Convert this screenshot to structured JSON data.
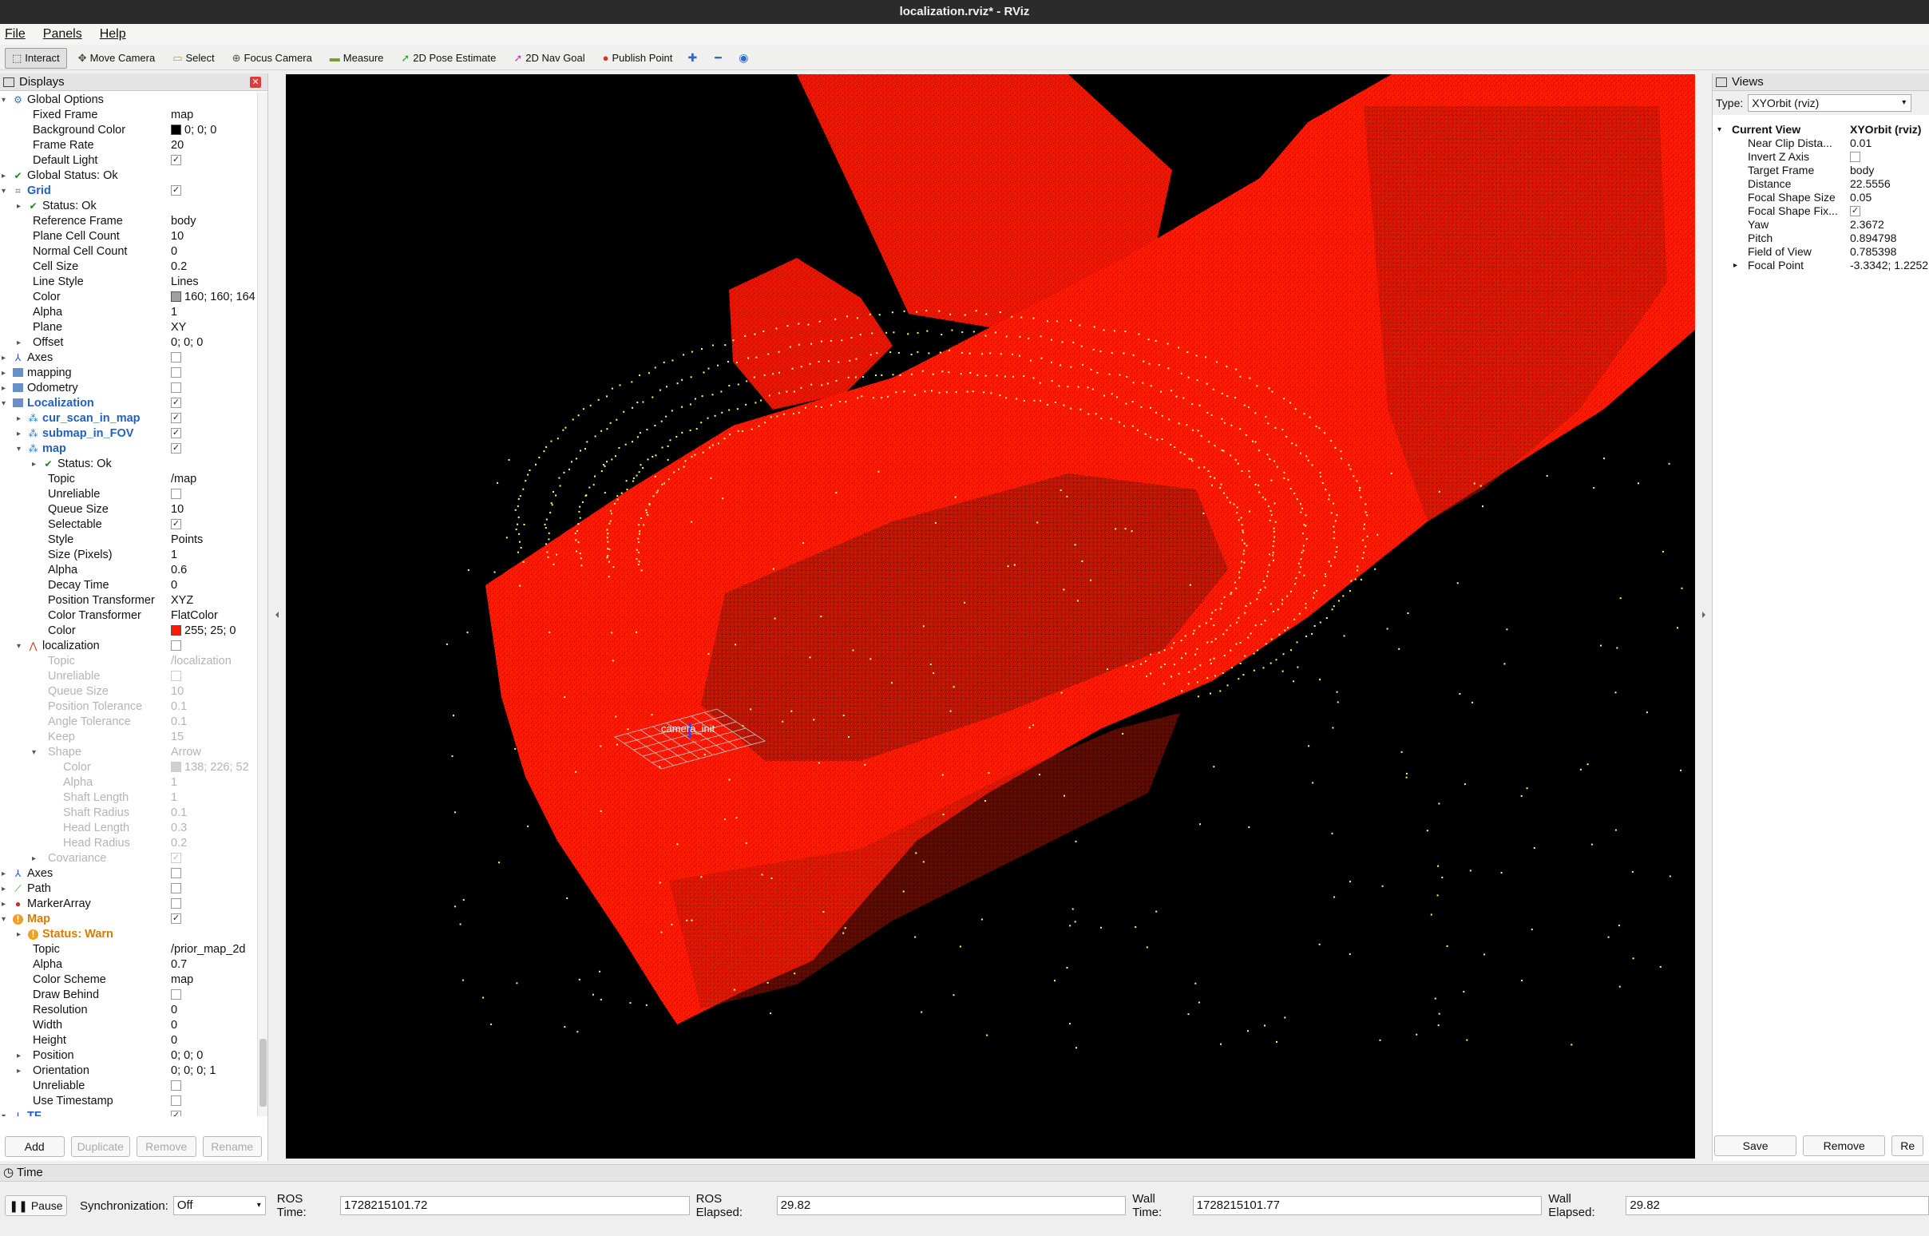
{
  "window": {
    "title": "localization.rviz* - RViz"
  },
  "menu": [
    "File",
    "Panels",
    "Help"
  ],
  "toolbar": [
    {
      "label": "Interact",
      "icon": "interact-icon",
      "active": true
    },
    {
      "label": "Move Camera",
      "icon": "move-camera-icon"
    },
    {
      "label": "Select",
      "icon": "select-icon"
    },
    {
      "label": "Focus Camera",
      "icon": "focus-camera-icon"
    },
    {
      "label": "Measure",
      "icon": "measure-icon"
    },
    {
      "label": "2D Pose Estimate",
      "icon": "pose-estimate-icon"
    },
    {
      "label": "2D Nav Goal",
      "icon": "nav-goal-icon"
    },
    {
      "label": "Publish Point",
      "icon": "publish-point-icon"
    }
  ],
  "displays": {
    "title": "Displays",
    "rows": [
      {
        "d": 0,
        "arrow": "▾",
        "icon": "gear",
        "label": "Global Options"
      },
      {
        "d": 1,
        "label": "Fixed Frame",
        "value": "map"
      },
      {
        "d": 1,
        "label": "Background Color",
        "value": "0; 0; 0",
        "swatch": "#000000"
      },
      {
        "d": 1,
        "label": "Frame Rate",
        "value": "20"
      },
      {
        "d": 1,
        "label": "Default Light",
        "check": true
      },
      {
        "d": 0,
        "arrow": "▸",
        "icon": "ok",
        "label": "Global Status: Ok"
      },
      {
        "d": 0,
        "arrow": "▾",
        "icon": "grid",
        "label": "Grid",
        "style": "blue",
        "check": true
      },
      {
        "d": 1,
        "arrow": "▸",
        "icon": "ok",
        "label": "Status: Ok"
      },
      {
        "d": 1,
        "label": "Reference Frame",
        "value": "body"
      },
      {
        "d": 1,
        "label": "Plane Cell Count",
        "value": "10"
      },
      {
        "d": 1,
        "label": "Normal Cell Count",
        "value": "0"
      },
      {
        "d": 1,
        "label": "Cell Size",
        "value": "0.2"
      },
      {
        "d": 1,
        "label": "Line Style",
        "value": "Lines"
      },
      {
        "d": 1,
        "label": "Color",
        "value": "160; 160; 164",
        "swatch": "#a0a0a4"
      },
      {
        "d": 1,
        "label": "Alpha",
        "value": "1"
      },
      {
        "d": 1,
        "label": "Plane",
        "value": "XY"
      },
      {
        "d": 1,
        "arrow": "▸",
        "label": "Offset",
        "value": "0; 0; 0"
      },
      {
        "d": 0,
        "arrow": "▸",
        "icon": "axes",
        "label": "Axes",
        "check": false
      },
      {
        "d": 0,
        "arrow": "▸",
        "icon": "folder",
        "label": "mapping",
        "check": false
      },
      {
        "d": 0,
        "arrow": "▸",
        "icon": "folder",
        "label": "Odometry",
        "check": false
      },
      {
        "d": 0,
        "arrow": "▾",
        "icon": "folder",
        "label": "Localization",
        "style": "blue",
        "check": true
      },
      {
        "d": 1,
        "arrow": "▸",
        "icon": "cloud",
        "label": "cur_scan_in_map",
        "style": "blue",
        "check": true
      },
      {
        "d": 1,
        "arrow": "▸",
        "icon": "cloud",
        "label": "submap_in_FOV",
        "style": "blue",
        "check": true
      },
      {
        "d": 1,
        "arrow": "▾",
        "icon": "cloud",
        "label": "map",
        "style": "blue",
        "check": true
      },
      {
        "d": 2,
        "arrow": "▸",
        "icon": "ok",
        "label": "Status: Ok"
      },
      {
        "d": 2,
        "label": "Topic",
        "value": "/map"
      },
      {
        "d": 2,
        "label": "Unreliable",
        "check": false
      },
      {
        "d": 2,
        "label": "Queue Size",
        "value": "10"
      },
      {
        "d": 2,
        "label": "Selectable",
        "check": true
      },
      {
        "d": 2,
        "label": "Style",
        "value": "Points"
      },
      {
        "d": 2,
        "label": "Size (Pixels)",
        "value": "1"
      },
      {
        "d": 2,
        "label": "Alpha",
        "value": "0.6"
      },
      {
        "d": 2,
        "label": "Decay Time",
        "value": "0"
      },
      {
        "d": 2,
        "label": "Position Transformer",
        "value": "XYZ"
      },
      {
        "d": 2,
        "label": "Color Transformer",
        "value": "FlatColor"
      },
      {
        "d": 2,
        "label": "Color",
        "value": "255; 25; 0",
        "swatch": "#ff1900"
      },
      {
        "d": 1,
        "arrow": "▾",
        "icon": "odom",
        "label": "localization",
        "check": false
      },
      {
        "d": 2,
        "label": "Topic",
        "value": "/localization",
        "style": "dim"
      },
      {
        "d": 2,
        "label": "Unreliable",
        "check": false,
        "style": "dim"
      },
      {
        "d": 2,
        "label": "Queue Size",
        "value": "10",
        "style": "dim"
      },
      {
        "d": 2,
        "label": "Position Tolerance",
        "value": "0.1",
        "style": "dim"
      },
      {
        "d": 2,
        "label": "Angle Tolerance",
        "value": "0.1",
        "style": "dim"
      },
      {
        "d": 2,
        "label": "Keep",
        "value": "15",
        "style": "dim"
      },
      {
        "d": 2,
        "arrow": "▾",
        "label": "Shape",
        "value": "Arrow",
        "style": "dim"
      },
      {
        "d": 3,
        "label": "Color",
        "value": "138; 226; 52",
        "swatch": "#d0d0d0",
        "style": "dim"
      },
      {
        "d": 3,
        "label": "Alpha",
        "value": "1",
        "style": "dim"
      },
      {
        "d": 3,
        "label": "Shaft Length",
        "value": "1",
        "style": "dim"
      },
      {
        "d": 3,
        "label": "Shaft Radius",
        "value": "0.1",
        "style": "dim"
      },
      {
        "d": 3,
        "label": "Head Length",
        "value": "0.3",
        "style": "dim"
      },
      {
        "d": 3,
        "label": "Head Radius",
        "value": "0.2",
        "style": "dim"
      },
      {
        "d": 2,
        "arrow": "▸",
        "label": "Covariance",
        "check": true,
        "style": "dim"
      },
      {
        "d": 0,
        "arrow": "▸",
        "icon": "axes",
        "label": "Axes",
        "check": false
      },
      {
        "d": 0,
        "arrow": "▸",
        "icon": "path",
        "label": "Path",
        "check": false
      },
      {
        "d": 0,
        "arrow": "▸",
        "icon": "marker",
        "label": "MarkerArray",
        "check": false
      },
      {
        "d": 0,
        "arrow": "▾",
        "icon": "warn",
        "label": "Map",
        "style": "orange",
        "check": true
      },
      {
        "d": 1,
        "arrow": "▸",
        "icon": "warn",
        "label": "Status: Warn",
        "style": "orange"
      },
      {
        "d": 1,
        "label": "Topic",
        "value": "/prior_map_2d"
      },
      {
        "d": 1,
        "label": "Alpha",
        "value": "0.7"
      },
      {
        "d": 1,
        "label": "Color Scheme",
        "value": "map"
      },
      {
        "d": 1,
        "label": "Draw Behind",
        "check": false
      },
      {
        "d": 1,
        "label": "Resolution",
        "value": "0"
      },
      {
        "d": 1,
        "label": "Width",
        "value": "0"
      },
      {
        "d": 1,
        "label": "Height",
        "value": "0"
      },
      {
        "d": 1,
        "arrow": "▸",
        "label": "Position",
        "value": "0; 0; 0"
      },
      {
        "d": 1,
        "arrow": "▸",
        "label": "Orientation",
        "value": "0; 0; 0; 1"
      },
      {
        "d": 1,
        "label": "Unreliable",
        "check": false
      },
      {
        "d": 1,
        "label": "Use Timestamp",
        "check": false
      },
      {
        "d": 0,
        "arrow": "▾",
        "icon": "tf",
        "label": "TF",
        "style": "blue",
        "check": true
      }
    ],
    "buttons": [
      {
        "label": "Add",
        "enabled": true
      },
      {
        "label": "Duplicate",
        "enabled": false
      },
      {
        "label": "Remove",
        "enabled": false
      },
      {
        "label": "Rename",
        "enabled": false
      }
    ]
  },
  "viewport": {
    "frame_label": "camera_init"
  },
  "views": {
    "title": "Views",
    "type_label": "Type:",
    "type_value": "XYOrbit (rviz)",
    "header_label": "Current View",
    "header_value": "XYOrbit (rviz)",
    "rows": [
      {
        "label": "Near Clip Dista...",
        "value": "0.01"
      },
      {
        "label": "Invert Z Axis",
        "check": false
      },
      {
        "label": "Target Frame",
        "value": "body"
      },
      {
        "label": "Distance",
        "value": "22.5556"
      },
      {
        "label": "Focal Shape Size",
        "value": "0.05"
      },
      {
        "label": "Focal Shape Fix...",
        "check": true
      },
      {
        "label": "Yaw",
        "value": "2.3672"
      },
      {
        "label": "Pitch",
        "value": "0.894798"
      },
      {
        "label": "Field of View",
        "value": "0.785398"
      },
      {
        "label": "Focal Point",
        "value": "-3.3342; 1.2252",
        "arrow": "▸"
      }
    ],
    "buttons": [
      "Save",
      "Remove",
      "Re"
    ]
  },
  "time": {
    "title": "Time",
    "pause": "Pause",
    "sync_label": "Synchronization:",
    "sync_value": "Off",
    "ros_time_label": "ROS Time:",
    "ros_time": "1728215101.72",
    "ros_elapsed_label": "ROS Elapsed:",
    "ros_elapsed": "29.82",
    "wall_time_label": "Wall Time:",
    "wall_time": "1728215101.77",
    "wall_elapsed_label": "Wall Elapsed:",
    "wall_elapsed": "29.82"
  },
  "colors": {
    "map_points": "#ff1900",
    "scan_points": "#ffff55",
    "background": "#000000"
  }
}
